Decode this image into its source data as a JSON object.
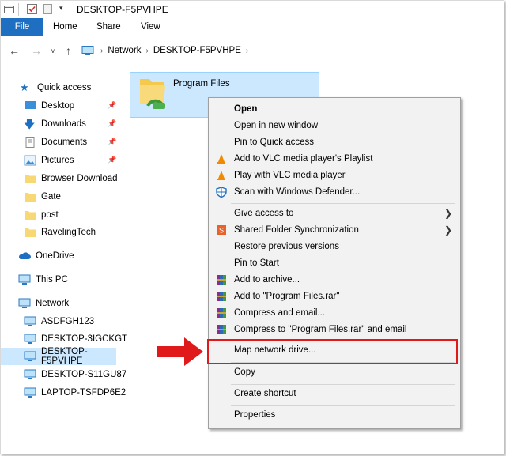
{
  "window": {
    "title": "DESKTOP-F5PVHPE"
  },
  "ribbon": {
    "tabs": [
      "File",
      "Home",
      "Share",
      "View"
    ]
  },
  "address": {
    "segments": [
      "Network",
      "DESKTOP-F5PVHPE"
    ]
  },
  "nav": {
    "quick_access": "Quick access",
    "items": [
      {
        "label": "Desktop",
        "pinned": true
      },
      {
        "label": "Downloads",
        "pinned": true
      },
      {
        "label": "Documents",
        "pinned": true
      },
      {
        "label": "Pictures",
        "pinned": true
      },
      {
        "label": "Browser Download"
      },
      {
        "label": "Gate"
      },
      {
        "label": "post"
      },
      {
        "label": "RavelingTech"
      }
    ],
    "onedrive": "OneDrive",
    "this_pc": "This PC",
    "network": "Network",
    "network_items": [
      "ASDFGH123",
      "DESKTOP-3IGCKGT",
      "DESKTOP-F5PVHPE",
      "DESKTOP-S11GU87",
      "LAPTOP-TSFDP6E2"
    ],
    "selected": "DESKTOP-F5PVHPE"
  },
  "content": {
    "folder_name": "Program Files"
  },
  "context_menu": {
    "items": [
      {
        "label": "Open",
        "bold": true
      },
      {
        "label": "Open in new window"
      },
      {
        "label": "Pin to Quick access"
      },
      {
        "label": "Add to VLC media player's Playlist",
        "icon": "vlc-icon"
      },
      {
        "label": "Play with VLC media player",
        "icon": "vlc-icon"
      },
      {
        "label": "Scan with Windows Defender...",
        "icon": "defender-icon"
      },
      {
        "label": "Give access to",
        "submenu": true
      },
      {
        "label": "Shared Folder Synchronization",
        "submenu": true,
        "icon": "sync-icon"
      },
      {
        "label": "Restore previous versions"
      },
      {
        "label": "Pin to Start"
      },
      {
        "label": "Add to archive...",
        "icon": "winrar-icon"
      },
      {
        "label": "Add to \"Program Files.rar\"",
        "icon": "winrar-icon"
      },
      {
        "label": "Compress and email...",
        "icon": "winrar-icon"
      },
      {
        "label": "Compress to \"Program Files.rar\" and email",
        "icon": "winrar-icon"
      },
      {
        "label": "Map network drive..."
      },
      {
        "label": "Copy"
      },
      {
        "label": "Create shortcut"
      },
      {
        "label": "Properties"
      }
    ]
  },
  "colors": {
    "accent": "#1e6fc1",
    "selection": "#cce8ff",
    "highlight": "#e01a1a"
  }
}
